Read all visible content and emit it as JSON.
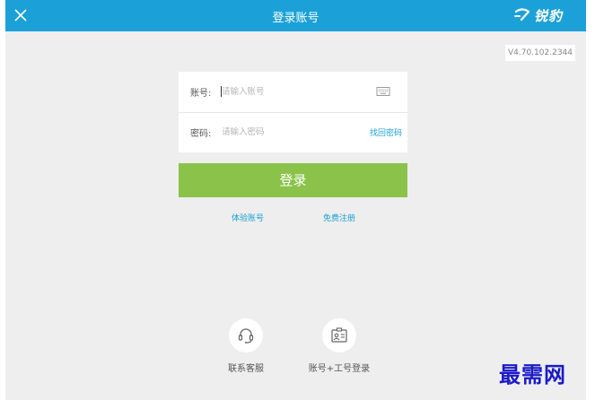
{
  "header": {
    "title": "登录账号",
    "brand": "锐豹"
  },
  "version": "V4.70.102.2344",
  "form": {
    "account_label": "账号:",
    "account_placeholder": "请输入账号",
    "password_label": "密码:",
    "password_placeholder": "请输入密码",
    "find_password": "找回密码"
  },
  "login_button": "登录",
  "links": {
    "trial": "体验账号",
    "register": "免费注册"
  },
  "bottom": {
    "service": "联系客服",
    "staff_login": "账号+工号登录"
  },
  "watermark": "最需网",
  "colors": {
    "header": "#1ba1d8",
    "login_button": "#8bc34a",
    "link": "#1ba1d8",
    "background": "#eeeeee"
  },
  "icons": {
    "close": "close-icon",
    "brand": "brand-logo-icon",
    "keyboard": "keyboard-icon",
    "service": "headset-icon",
    "staff": "id-card-icon"
  }
}
